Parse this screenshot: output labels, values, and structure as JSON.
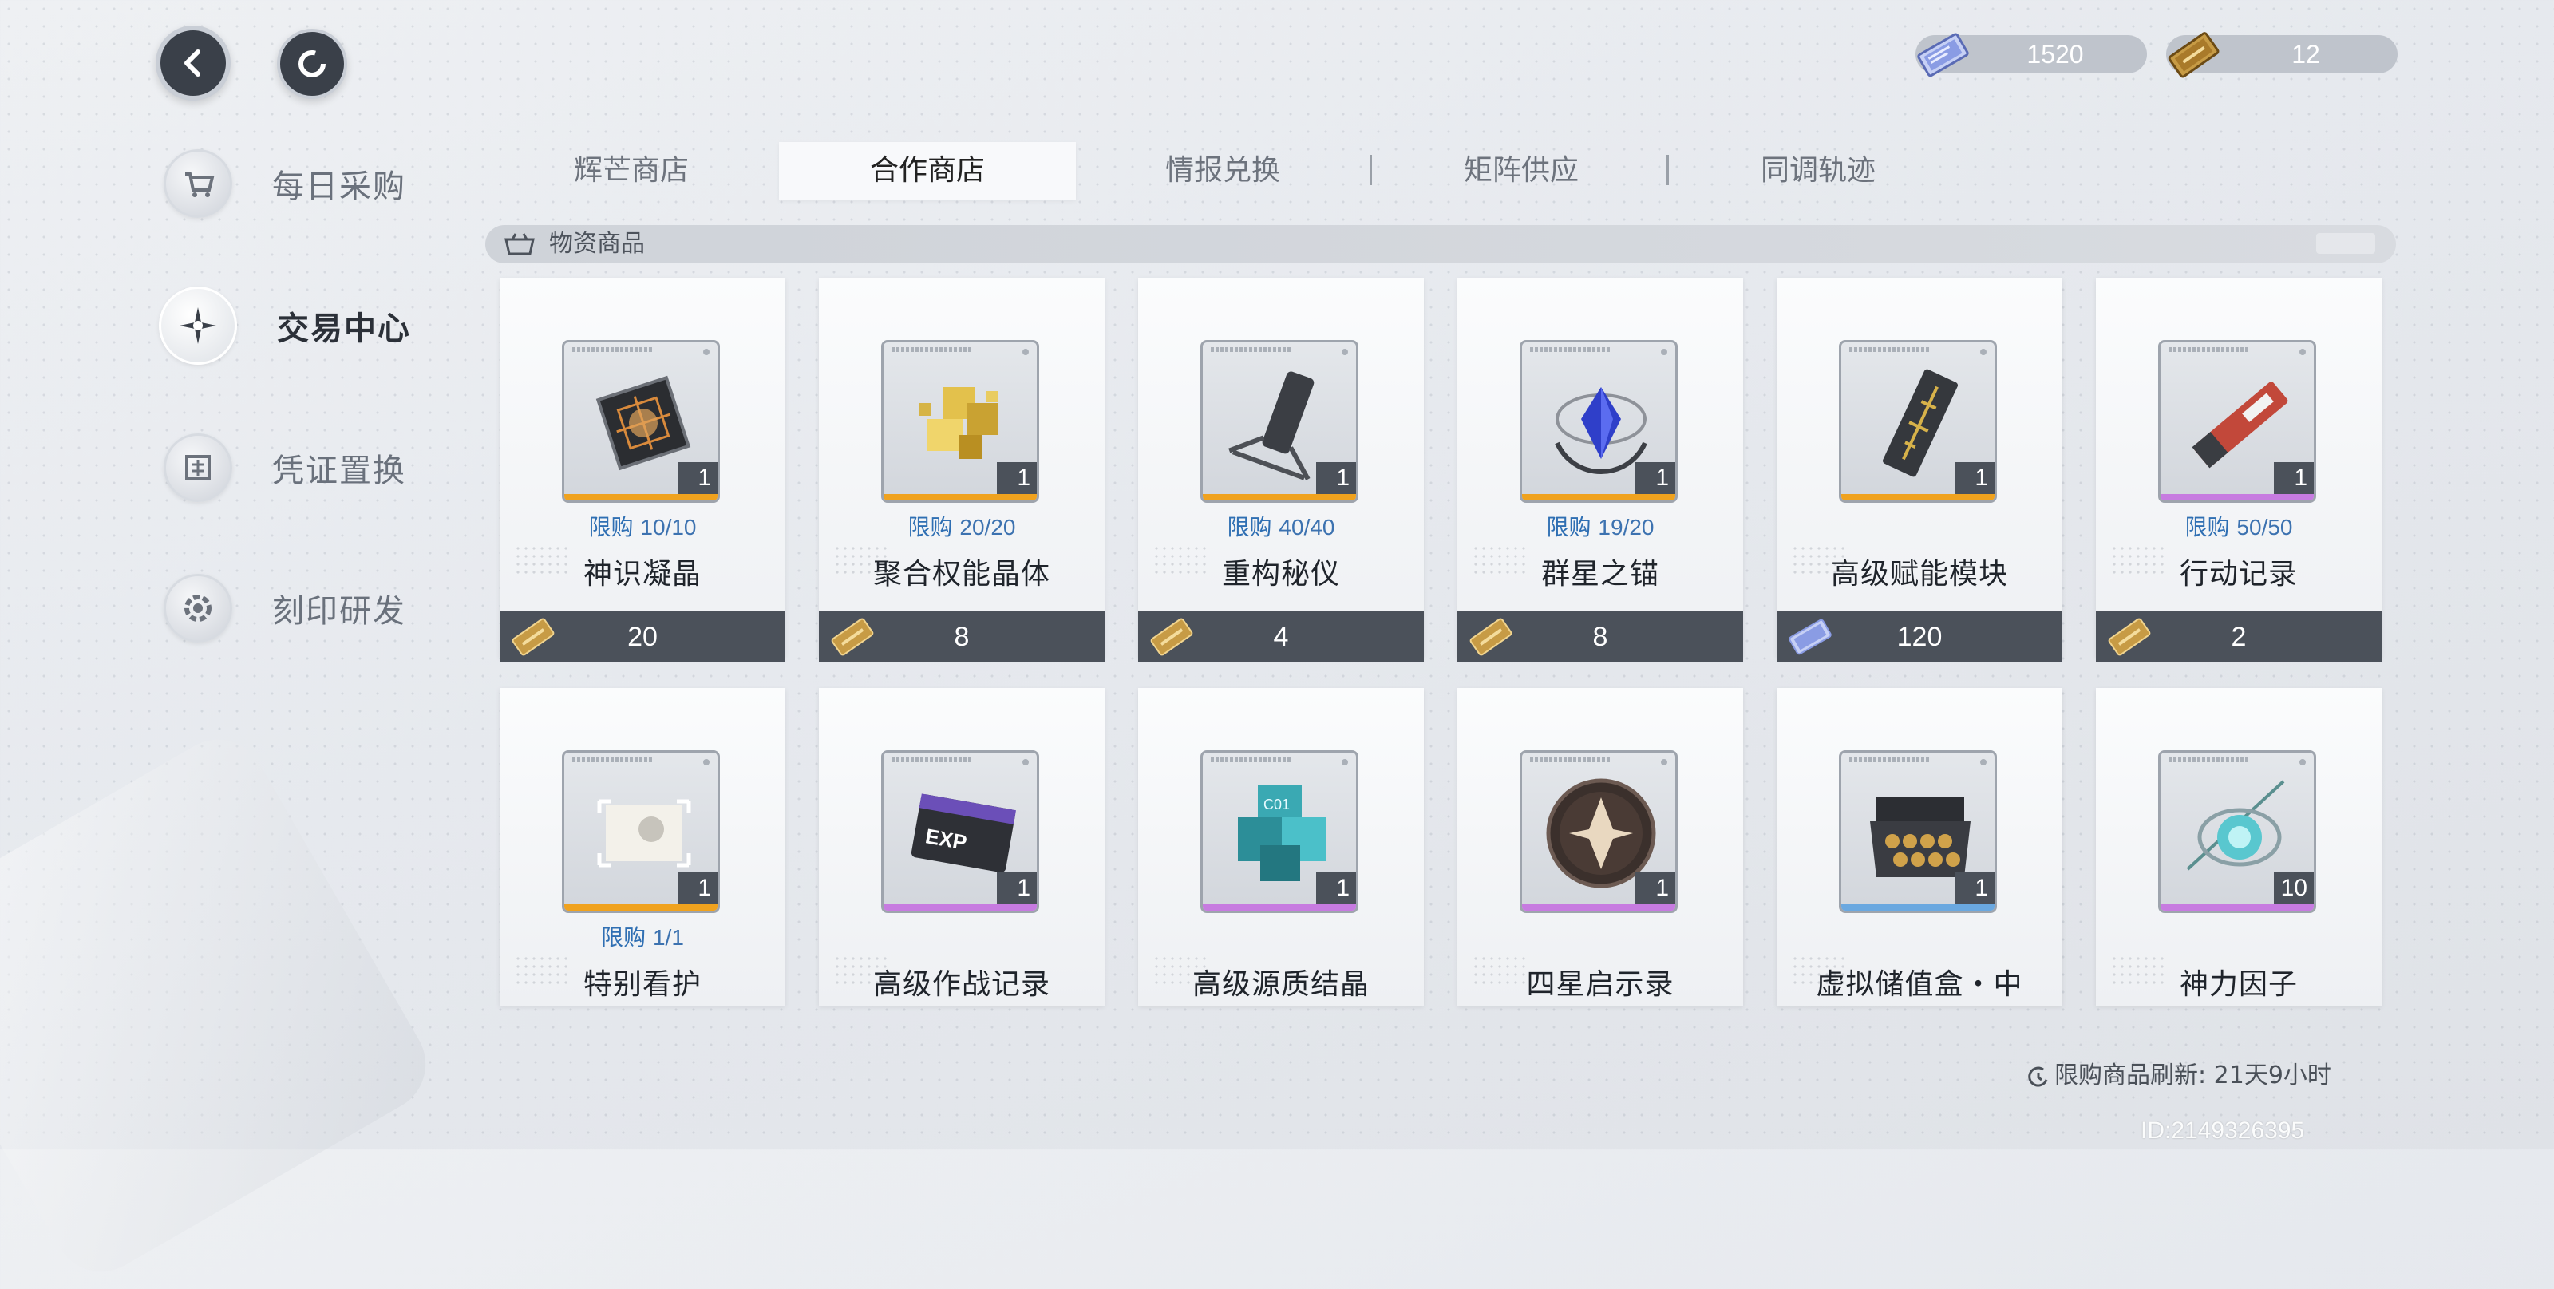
{
  "currencies": [
    {
      "name": "crystal",
      "icon": "crystal-card-icon",
      "value": "1520"
    },
    {
      "name": "ticket",
      "icon": "gold-ticket-icon",
      "value": "12"
    }
  ],
  "sidebar": {
    "items": [
      {
        "label": "每日采购",
        "icon": "cart-icon",
        "active": false
      },
      {
        "label": "交易中心",
        "icon": "compass-star-icon",
        "active": true
      },
      {
        "label": "凭证置换",
        "icon": "voucher-icon",
        "active": false
      },
      {
        "label": "刻印研发",
        "icon": "gear-icon",
        "active": false
      }
    ]
  },
  "tabs": [
    {
      "label": "辉芒商店",
      "active": false
    },
    {
      "label": "合作商店",
      "active": true
    },
    {
      "label": "情报兑换",
      "active": false
    },
    {
      "label": "矩阵供应",
      "active": false
    },
    {
      "label": "同调轨迹",
      "active": false
    }
  ],
  "section": {
    "title": "物资商品"
  },
  "limit_prefix": "限购",
  "items": [
    {
      "name": "神识凝晶",
      "qty": "1",
      "limit": "10/10",
      "price": "20",
      "currency_icon": "gold-ticket-icon",
      "quality_color": "#f0a21e",
      "art": "cube"
    },
    {
      "name": "聚合权能晶体",
      "qty": "1",
      "limit": "20/20",
      "price": "8",
      "currency_icon": "gold-ticket-icon",
      "quality_color": "#f0a21e",
      "art": "gold"
    },
    {
      "name": "重构秘仪",
      "qty": "1",
      "limit": "40/40",
      "price": "4",
      "currency_icon": "gold-ticket-icon",
      "quality_color": "#f0a21e",
      "art": "device"
    },
    {
      "name": "群星之锚",
      "qty": "1",
      "limit": "19/20",
      "price": "8",
      "currency_icon": "gold-ticket-icon",
      "quality_color": "#f0a21e",
      "art": "anchor"
    },
    {
      "name": "高级赋能模块",
      "qty": "1",
      "limit": "",
      "price": "120",
      "currency_icon": "crystal-card-icon",
      "quality_color": "#f0a21e",
      "art": "module"
    },
    {
      "name": "行动记录",
      "qty": "1",
      "limit": "50/50",
      "price": "2",
      "currency_icon": "gold-ticket-icon",
      "quality_color": "#c77be0",
      "art": "record"
    },
    {
      "name": "特别看护",
      "qty": "1",
      "limit": "1/1",
      "quality_color": "#f0a21e",
      "art": "photo"
    },
    {
      "name": "高级作战记录",
      "qty": "1",
      "limit": "",
      "quality_color": "#c77be0",
      "art": "exp"
    },
    {
      "name": "高级源质结晶",
      "qty": "1",
      "limit": "",
      "quality_color": "#c77be0",
      "art": "crystal"
    },
    {
      "name": "四星启示录",
      "qty": "1",
      "limit": "",
      "quality_color": "#c77be0",
      "art": "medal"
    },
    {
      "name": "虚拟储值盒・中",
      "qty": "1",
      "limit": "",
      "quality_color": "#6aa8e0",
      "art": "box"
    },
    {
      "name": "神力因子",
      "qty": "10",
      "limit": "",
      "quality_color": "#c77be0",
      "art": "factor"
    }
  ],
  "refresh_note": "限购商品刷新: 21天9小时",
  "uid": "ID:2149326395",
  "icons": {
    "back": "back-arrow-icon",
    "refresh": "refresh-icon",
    "refresh_note": "clock-icon",
    "section": "crate-icon"
  }
}
